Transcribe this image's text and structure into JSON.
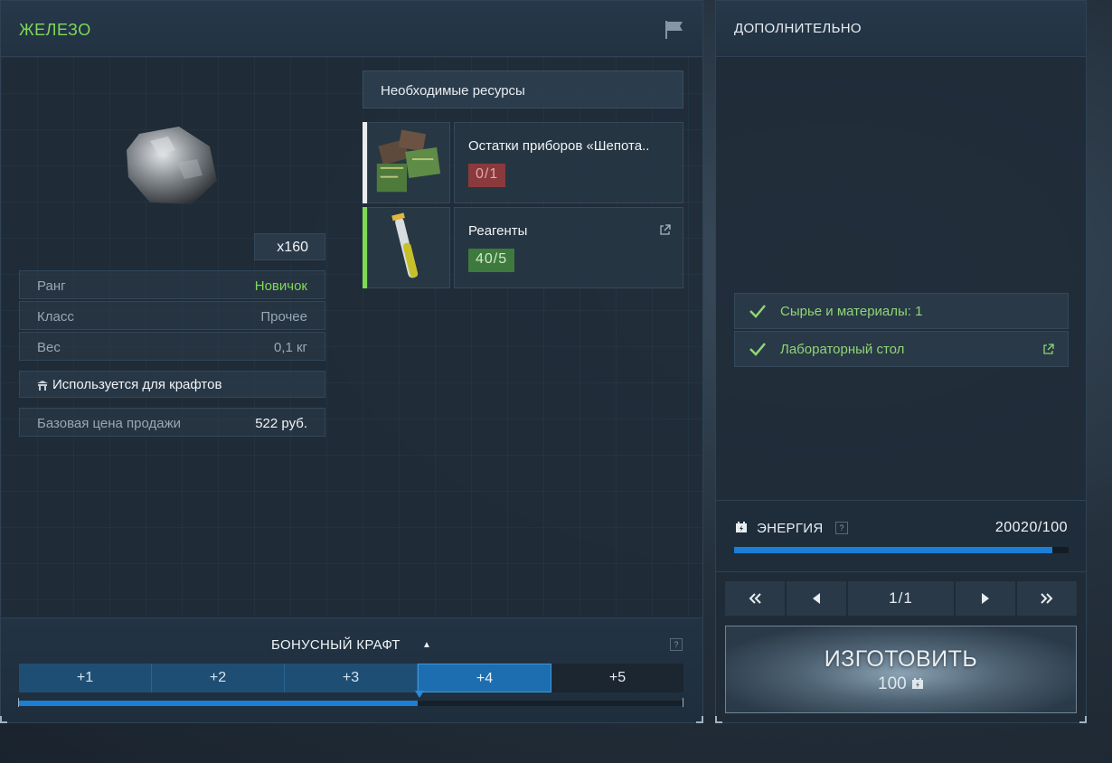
{
  "item": {
    "name": "ЖЕЛЕЗО",
    "quantity": "x160",
    "stats": [
      {
        "label": "Ранг",
        "value": "Новичок"
      },
      {
        "label": "Класс",
        "value": "Прочее"
      },
      {
        "label": "Вес",
        "value": "0,1 кг"
      }
    ],
    "craft_note": "Используется для крафтов",
    "price_label": "Базовая цена продажи",
    "price_value": "522 руб."
  },
  "resources": {
    "header": "Необходимые ресурсы",
    "items": [
      {
        "name": "Остатки приборов «Шепота..",
        "count": "0/1",
        "status": "missing",
        "color": "#8a3a3c"
      },
      {
        "name": "Реагенты",
        "count": "40/5",
        "status": "ok",
        "color": "#3e7a3d"
      }
    ]
  },
  "bonus": {
    "title": "БОНУСНЫЙ КРАФТ",
    "help": "?",
    "tabs": [
      "+1",
      "+2",
      "+3",
      "+4",
      "+5"
    ],
    "active_tab": "+4",
    "progress": 0.6
  },
  "extra": {
    "title": "ДОПОЛНИТЕЛЬНО",
    "requirements": [
      {
        "text": "Сырье и материалы: 1",
        "met": true
      },
      {
        "text": "Лабораторный стол",
        "met": true
      }
    ]
  },
  "energy": {
    "label": "ЭНЕРГИЯ",
    "help": "?",
    "value": "20020/100",
    "fill": 0.95,
    "accent": "#1c7fd6"
  },
  "pager": {
    "page": "1/1"
  },
  "craft": {
    "label": "ИЗГОТОВИТЬ",
    "cost": "100"
  },
  "colors": {
    "accent_green": "#7ed957",
    "accent_blue": "#1c7fd6"
  },
  "icons": [
    "flag-icon",
    "external-link-icon",
    "check-icon",
    "energy-icon",
    "first-page-icon",
    "prev-page-icon",
    "next-page-icon",
    "last-page-icon"
  ]
}
